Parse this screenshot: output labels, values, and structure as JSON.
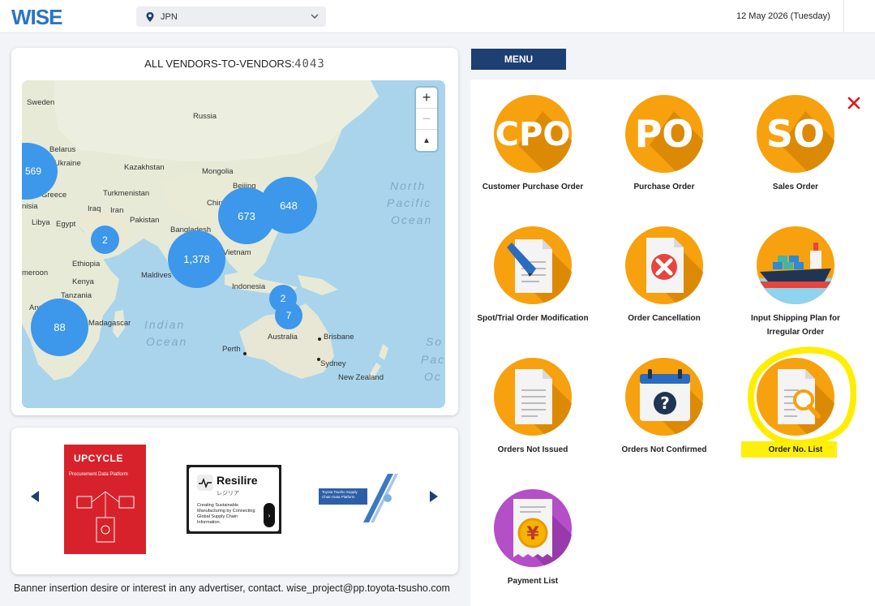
{
  "header": {
    "logo_text": "WISE",
    "country": "JPN",
    "date": "12 May 2026 (Tuesday)"
  },
  "map": {
    "title": "ALL VENDORS-TO-VENDORS:",
    "count": "4043",
    "zoom_in": "+",
    "zoom_out": "−",
    "reset": "▲",
    "clusters": [
      "569",
      "673",
      "648",
      "2",
      "1,378",
      "2",
      "7",
      "88"
    ],
    "labels": [
      "Sweden",
      "Russia",
      "Belarus",
      "Ukraine",
      "Kazakhstan",
      "Mongolia",
      "Greece",
      "Turkmenistan",
      "Beijing",
      "Libya",
      "Egypt",
      "Iraq",
      "Iran",
      "Pakistan",
      "China",
      "Bangladesh",
      "Ethiopia",
      "Maldives",
      "Vietnam",
      "Indonesia",
      "Kenya",
      "Tanzania",
      "Madagascar",
      "Australia",
      "Brisbane",
      "Perth",
      "Sydney",
      "New Zealand",
      "nisia",
      "meroon",
      "Ang"
    ],
    "oceans": [
      "North",
      "Pacific",
      "Ocean",
      "Indian",
      "Ocean",
      "So",
      "Pac",
      "Oc"
    ]
  },
  "banners": {
    "upcycle_title": "UPCYCLE",
    "upcycle_sub": "Procurement Data Platform",
    "resilire_title": "Resilire",
    "resilire_kana": "レジリア",
    "resilire_desc": "Creating Sustainable Manufacturing by Connecting Global Supply Chain Information.",
    "toyota_text": "Toyota Tsusho Supply Chain Data Platform"
  },
  "contact": "Banner insertion desire or interest in any advertiser, contact. wise_project@pp.toyota-tsusho.com",
  "menu": {
    "tab": "MENU",
    "items": [
      {
        "label": "Customer Purchase Order",
        "icon_text": "CPO"
      },
      {
        "label": "Purchase Order",
        "icon_text": "PO"
      },
      {
        "label": "Sales Order",
        "icon_text": "SO"
      },
      {
        "label": "Spot/Trial Order Modification",
        "icon_text": ""
      },
      {
        "label": "Order Cancellation",
        "icon_text": ""
      },
      {
        "label": "Input Shipping Plan for Irregular Order",
        "icon_text": ""
      },
      {
        "label": "Orders Not Issued",
        "icon_text": ""
      },
      {
        "label": "Orders Not Confirmed",
        "icon_text": "?"
      },
      {
        "label": "Order No. List",
        "icon_text": ""
      },
      {
        "label": "Payment List",
        "icon_text": "¥"
      }
    ]
  },
  "colors": {
    "brand_navy": "#1d3f72",
    "logo_blue": "#2a74c8",
    "tile_orange": "#f7a10e",
    "tile_purple": "#b44fc7",
    "cluster_blue": "#3d97ea",
    "close_red": "#e8141b",
    "highlight_yellow": "#ffee00"
  }
}
